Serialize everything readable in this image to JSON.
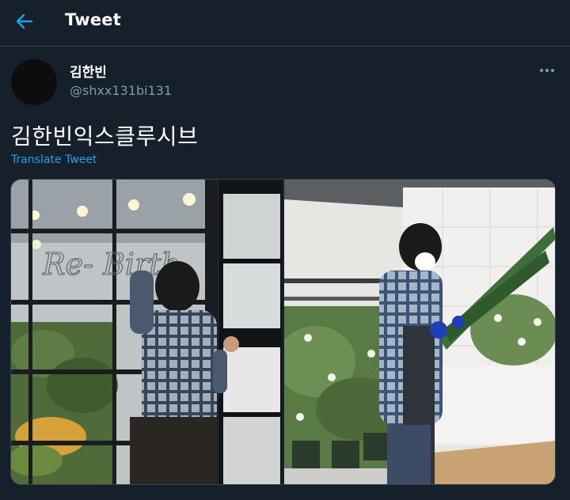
{
  "header": {
    "title": "Tweet",
    "back_icon": "arrow-left-icon"
  },
  "tweet": {
    "display_name": "김한빈",
    "handle": "@shxx131bi131",
    "text": "김한빈익스클루시브",
    "translate_label": "Translate Tweet",
    "more_icon": "more-horizontal-icon"
  },
  "media": {
    "photos": [
      {
        "sign_text": "Re- Birth"
      },
      {}
    ]
  },
  "colors": {
    "background": "#15202b",
    "border": "#38444d",
    "accent": "#1da1f2",
    "secondary_text": "#8899a6"
  }
}
